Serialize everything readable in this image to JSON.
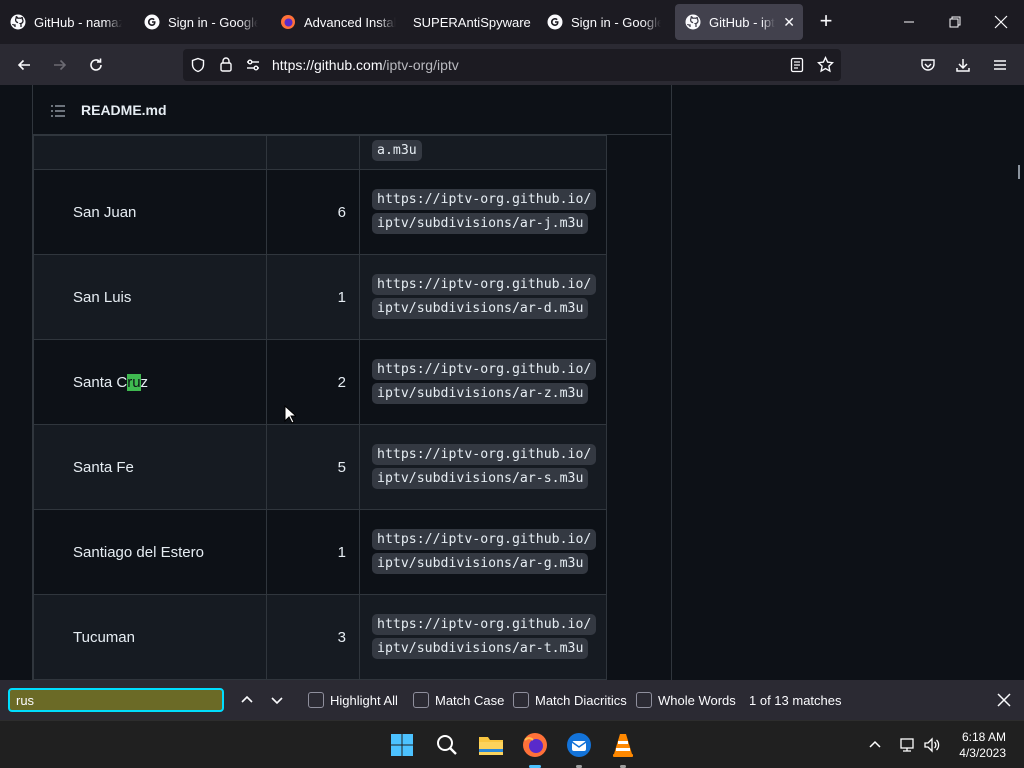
{
  "browser": {
    "tabs": [
      {
        "title": "GitHub - namazso/Ope",
        "icon": "github-icon"
      },
      {
        "title": "Sign in - Google Acco",
        "icon": "google-icon"
      },
      {
        "title": "Advanced Installer",
        "icon": "firefox-icon"
      },
      {
        "title": "SUPERAntiSpyware",
        "icon": "none"
      },
      {
        "title": "Sign in - Google Acco",
        "icon": "google-icon"
      },
      {
        "title": "GitHub - iptv-org",
        "icon": "github-icon",
        "active": true
      }
    ],
    "url_host": "https://github.com",
    "url_path": "/iptv-org/iptv"
  },
  "readme": {
    "header_label": "README.md"
  },
  "table": {
    "top_partial_url": "a.m3u",
    "rows": [
      {
        "name": "San Juan",
        "count": "6",
        "url": "https://iptv-org.github.io/iptv/subdivisions/ar-j.m3u"
      },
      {
        "name": "San Luis",
        "count": "1",
        "url": "https://iptv-org.github.io/iptv/subdivisions/ar-d.m3u"
      },
      {
        "name_before": "Santa C",
        "name_match": "ru",
        "name_after": "z",
        "count": "2",
        "url": "https://iptv-org.github.io/iptv/subdivisions/ar-z.m3u"
      },
      {
        "name": "Santa Fe",
        "count": "5",
        "url": "https://iptv-org.github.io/iptv/subdivisions/ar-s.m3u"
      },
      {
        "name": "Santiago del Estero",
        "count": "1",
        "url": "https://iptv-org.github.io/iptv/subdivisions/ar-g.m3u"
      },
      {
        "name": "Tucuman",
        "count": "3",
        "url": "https://iptv-org.github.io/iptv/subdivisions/ar-t.m3u"
      }
    ]
  },
  "findbar": {
    "query": "rus",
    "highlight_all": "Highlight All",
    "match_case": "Match Case",
    "match_diacritics": "Match Diacritics",
    "whole_words": "Whole Words",
    "status": "1 of 13 matches"
  },
  "taskbar": {
    "time": "6:18 AM",
    "date": "4/3/2023"
  },
  "colors": {
    "page_bg": "#0d1117",
    "find_highlight": "#3fb950",
    "find_field_bg": "#6b6a26",
    "focus_ring": "#00ddff"
  }
}
